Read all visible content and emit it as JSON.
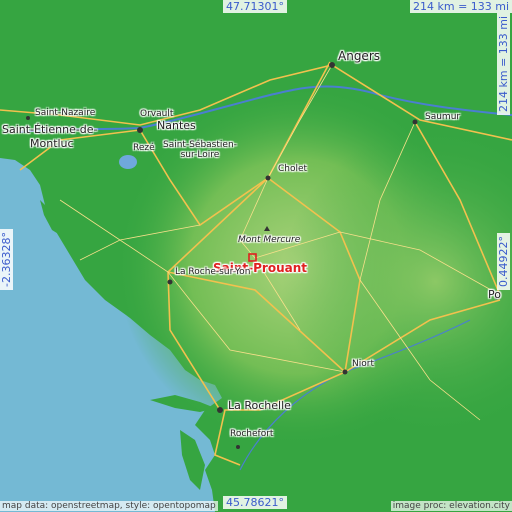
{
  "coordinates": {
    "top_lat": "47.71301°",
    "bottom_lat": "45.78621°",
    "left_lon": "-2.36328°",
    "right_lon": "0.44922°"
  },
  "scale": {
    "horizontal": "214 km = 133 mi",
    "vertical": "214 km = 133 mi"
  },
  "places": {
    "angers": "Angers",
    "saumur": "Saumur",
    "saint_nazaire": "Saint-Nazaire",
    "orvault": "Orvault",
    "nantes": "Nantes",
    "saint_etienne_line1": "Saint-Étienne-de-",
    "saint_etienne_line2": "Montluc",
    "reze": "Rezé",
    "saint_sebastien_line1": "Saint-Sébastien-",
    "saint_sebastien_line2": "sur-Loire",
    "cholet": "Cholet",
    "mont_mercure": "Mont Mercure",
    "la_roche": "La Roche-sur-Yon",
    "niort": "Niort",
    "la_rochelle": "La Rochelle",
    "rochefort": "Rochefort",
    "poitiers_partial": "Po"
  },
  "highlight": {
    "name": "Saint-Prouant",
    "color": "#e02020"
  },
  "footer": {
    "left": "map data: openstreetmap, style: opentopomap",
    "right": "image proc: elevation.city"
  },
  "colors": {
    "sea": "#74b9d4",
    "lowland": "#2fa43c",
    "upland": "#9ccf6a",
    "coord_text": "#3a5bcc",
    "road": "#f2c14e",
    "river": "#4a7fd0"
  }
}
